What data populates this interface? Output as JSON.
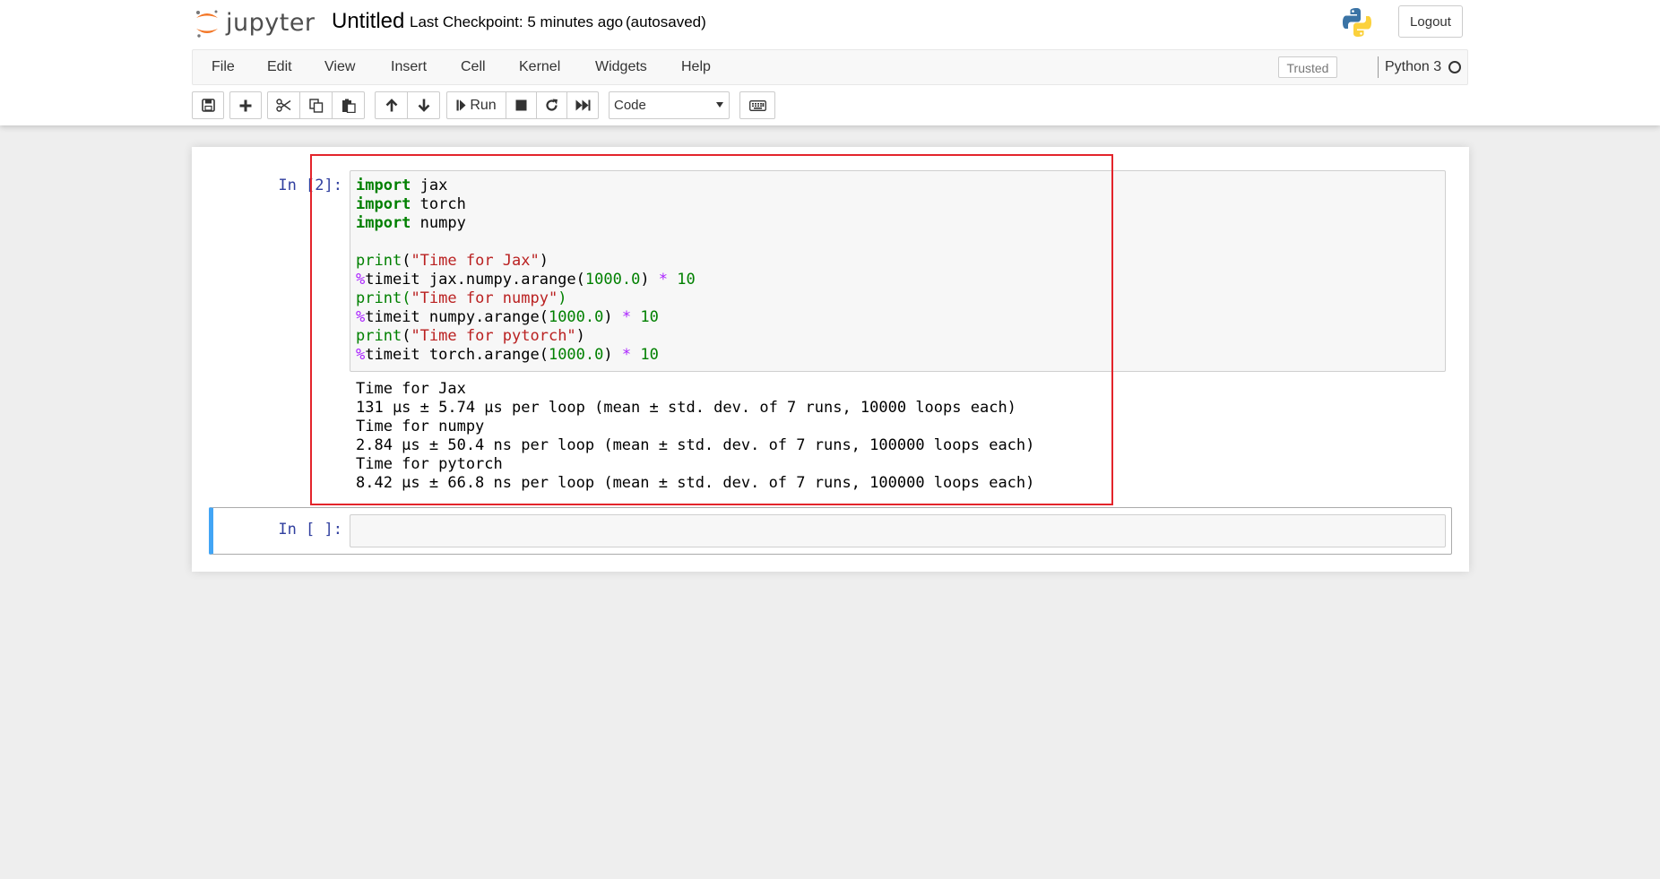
{
  "header": {
    "logo_text": "jupyter",
    "notebook_name": "Untitled",
    "checkpoint": "Last Checkpoint: 5 minutes ago",
    "autosave": "(autosaved)",
    "logout_label": "Logout"
  },
  "menubar": {
    "items": [
      "File",
      "Edit",
      "View",
      "Insert",
      "Cell",
      "Kernel",
      "Widgets",
      "Help"
    ],
    "trusted": "Trusted",
    "kernel": "Python 3"
  },
  "toolbar": {
    "run_label": "Run",
    "cell_type": "Code",
    "icons": [
      "save-icon",
      "plus-icon",
      "scissors-icon",
      "copy-icon",
      "paste-icon",
      "arrow-up-icon",
      "arrow-down-icon",
      "step-forward-icon",
      "stop-icon",
      "restart-icon",
      "fast-forward-icon",
      "keyboard-icon"
    ]
  },
  "cells": [
    {
      "prompt": "In [2]:",
      "code": [
        "import jax",
        "import torch",
        "import numpy",
        "",
        "print(\"Time for Jax\")",
        "%timeit jax.numpy.arange(1000.0) * 10",
        "print(\"Time for numpy\")",
        "%timeit numpy.arange(1000.0) * 10",
        "print(\"Time for pytorch\")",
        "%timeit torch.arange(1000.0) * 10"
      ],
      "output": [
        "Time for Jax",
        "131 µs ± 5.74 µs per loop (mean ± std. dev. of 7 runs, 10000 loops each)",
        "Time for numpy",
        "2.84 µs ± 50.4 ns per loop (mean ± std. dev. of 7 runs, 100000 loops each)",
        "Time for pytorch",
        "8.42 µs ± 66.8 ns per loop (mean ± std. dev. of 7 runs, 100000 loops each)"
      ]
    },
    {
      "prompt": "In [ ]:",
      "code": []
    }
  ],
  "colors": {
    "keyword": "#008000",
    "string": "#ba2121",
    "operator": "#aa22ff",
    "prompt": "#303f9f",
    "selected_cell_border": "#42a5f5",
    "annotation_box": "#e3242b"
  }
}
